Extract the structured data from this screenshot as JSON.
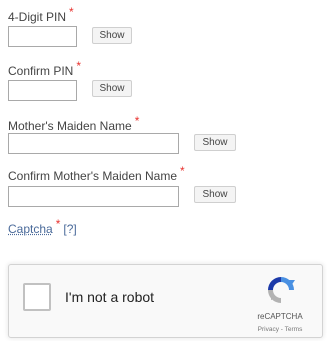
{
  "pin": {
    "label": "4-Digit PIN",
    "required_mark": "*",
    "value": "",
    "show_label": "Show"
  },
  "confirm_pin": {
    "label": "Confirm PIN",
    "required_mark": "*",
    "value": "",
    "show_label": "Show"
  },
  "maiden_name": {
    "label": "Mother's Maiden Name",
    "required_mark": "*",
    "value": "",
    "show_label": "Show"
  },
  "confirm_maiden_name": {
    "label": "Confirm Mother's Maiden Name",
    "required_mark": "*",
    "value": "",
    "show_label": "Show"
  },
  "captcha": {
    "label": "Captcha",
    "required_mark": "*",
    "help_link": "[?]"
  },
  "recaptcha": {
    "checkbox_label": "I'm not a robot",
    "brand": "reCAPTCHA",
    "privacy": "Privacy",
    "separator": "-",
    "terms": "Terms",
    "icon": "recaptcha-logo-icon",
    "colors": {
      "blue": "#4a90e2",
      "dark_blue": "#1c3aa9",
      "gray": "#b3b3b3"
    }
  },
  "colors": {
    "required": "#e8322e",
    "link": "#4a6a9a"
  }
}
